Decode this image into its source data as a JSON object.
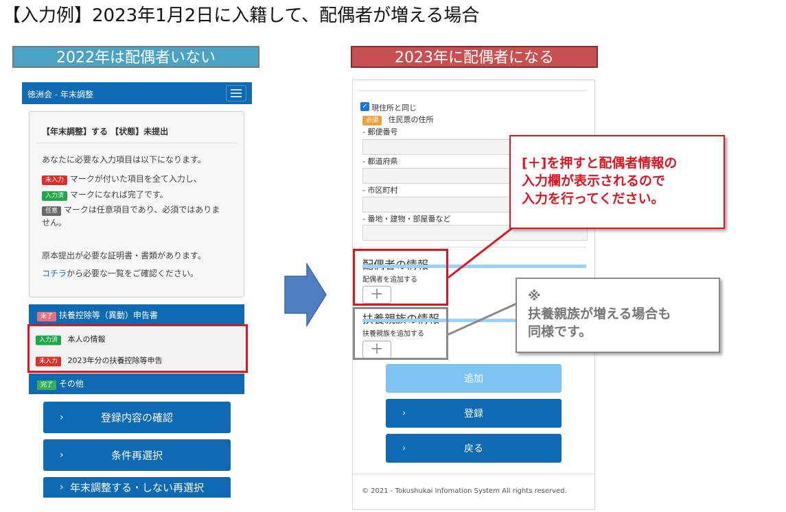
{
  "heading": "【入力例】2023年1月2日に入籍して、配偶者が増える場合",
  "banner_left": "2022年は配偶者いない",
  "banner_right": "2023年に配偶者になる",
  "left_screen": {
    "nav_title": "徳洲会 - 年末調整",
    "card": {
      "status": "【年末調整】する 【状態】未提出",
      "intro": "あなたに必要な入力項目は以下になります。",
      "badge_unentered": "未入力",
      "line_unentered": "マークが付いた項目を全て入力し、",
      "badge_entered": "入力済",
      "line_entered": "マークになれば完了です。",
      "badge_optional": "任意",
      "line_optional_1": "マークは任意項目であり、必須ではありま",
      "line_optional_2": "せん。",
      "docs_note": "原本提出が必要な証明書・書類があります。",
      "link_text": "コチラ",
      "link_after": "から必要な一覧をご確認ください。"
    },
    "section1": {
      "badge": "未了",
      "label": "扶養控除等（異動）申告書"
    },
    "items": [
      {
        "badge": "入力済",
        "label": "本人の情報"
      },
      {
        "badge": "未入力",
        "label": "2023年分の扶養控除等申告"
      }
    ],
    "section2": {
      "badge": "完了",
      "label": "その他"
    },
    "buttons": [
      "登録内容の確認",
      "条件再選択",
      "年末調整する・しない再選択"
    ]
  },
  "right_screen": {
    "same_address": "現住所と同じ",
    "required_badge": "必須",
    "resident_address": "住民票の住所",
    "postal_code": "- 郵便番号",
    "prefecture": "- 都道府県",
    "city": "- 市区町村",
    "street": "- 番地・建物・部屋番など",
    "spouse_title": "配偶者の情報",
    "spouse_add": "配偶者を追加する",
    "dependents_title": "扶養親族の情報",
    "dependents_add": "扶養親族を追加する",
    "plus": "＋",
    "btn_add": "追加",
    "btn_register": "登録",
    "btn_back": "戻る",
    "footer": "© 2021 - Tokushukai Infomation System All rights reserved."
  },
  "callout_red": [
    "[＋]を押すと配偶者情報の",
    "入力欄が表示されるので",
    "入力を行ってください。"
  ],
  "callout_gray": [
    "※",
    "扶養親族が増える場合も",
    "同様です。"
  ],
  "colors": {
    "nav_blue": "#0d6ab3",
    "highlight_red": "#e0141e",
    "banner_teal": "#4aa3c4",
    "banner_red": "#c85050",
    "add_button_disabled": "#7fc4f5"
  }
}
